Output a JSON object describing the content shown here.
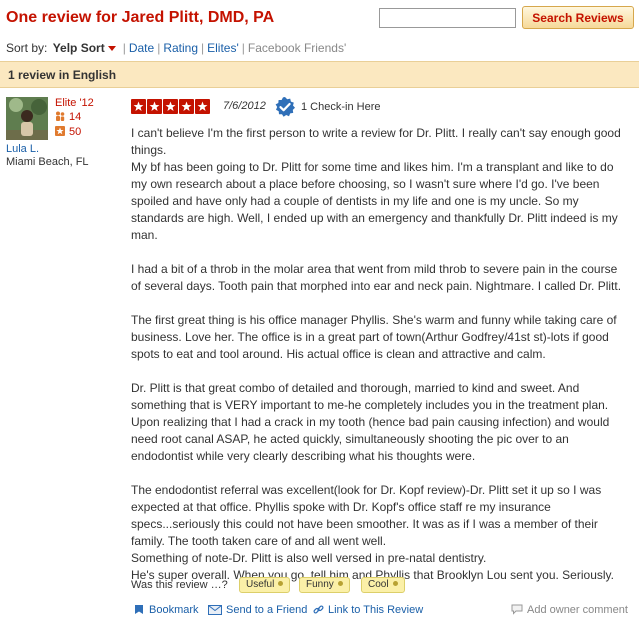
{
  "header": {
    "title": "One review for Jared Plitt, DMD, PA",
    "search_value": "",
    "search_button": "Search Reviews"
  },
  "sort": {
    "label": "Sort by:",
    "active": "Yelp Sort",
    "options": [
      "Date",
      "Rating",
      "Elites'"
    ],
    "muted_option": "Facebook Friends'"
  },
  "language_bar": "1 review in English",
  "review": {
    "user": {
      "name": "Lula L.",
      "location": "Miami Beach, FL",
      "elite": "Elite '12",
      "friends": "14",
      "reviews": "50"
    },
    "rating": 5,
    "date": "7/6/2012",
    "checkin": "1 Check-in Here",
    "lines": [
      "I can't believe I'm the first person to write a review for Dr. Plitt. I really can't say enough good",
      "things.",
      "My bf has been going to Dr. Plitt for some time and likes him. I'm a transplant and like to do",
      "my own research about a place before choosing, so I wasn't sure where I'd go. I've been",
      "spoiled and have only had a couple of dentists in my life and one is my uncle. So my",
      "standards are high. Well, I ended up with an emergency and thankfully Dr. Plitt indeed is my",
      "man.",
      "",
      "I had a bit of a throb in the molar area that went from mild throb to severe pain in the course",
      "of several days. Tooth pain that morphed into ear and neck pain. Nightmare. I called Dr. Plitt.",
      "",
      "The first great thing is his office manager Phyllis. She's warm and funny while taking care of",
      "business. Love her. The office is in a great part of town(Arthur Godfrey/41st st)-lots if good",
      "spots to eat and tool around. His actual office is clean and attractive and calm.",
      "",
      "Dr. Plitt is that great combo of detailed and thorough, married to kind and sweet. And",
      "something that is VERY important to me-he completely includes you in the treatment plan.",
      "Upon realizing that I had a crack in my tooth (hence bad pain causing infection) and would",
      "need root canal ASAP, he acted quickly, simultaneously shooting the pic over to an",
      "endodontist while very clearly describing what his thoughts were.",
      "",
      "The endodontist referral was excellent(look for Dr. Kopf review)-Dr. Plitt set it up so I was",
      "expected at that office. Phyllis spoke with Dr. Kopf's office staff re my insurance",
      "specs...seriously this could not have been smoother. It was as if I was a member of their",
      "family. The tooth taken care of and all went well.",
      "Something of note-Dr. Plitt is also well versed in pre-natal dentistry.",
      "He's super overall. When you go, tell him and Phyllis that Brooklyn Lou sent you. Seriously."
    ],
    "vote_prompt": "Was this review …?",
    "votes": [
      "Useful",
      "Funny",
      "Cool"
    ],
    "actions": {
      "bookmark": "Bookmark",
      "send": "Send to a Friend",
      "link": "Link to This Review",
      "owner_comment": "Add owner comment"
    }
  },
  "colors": {
    "accent_red": "#c41200",
    "link_blue": "#1a5fa8",
    "bar_bg": "#fbe8c0",
    "vote_bg": "#fbf0a8"
  }
}
